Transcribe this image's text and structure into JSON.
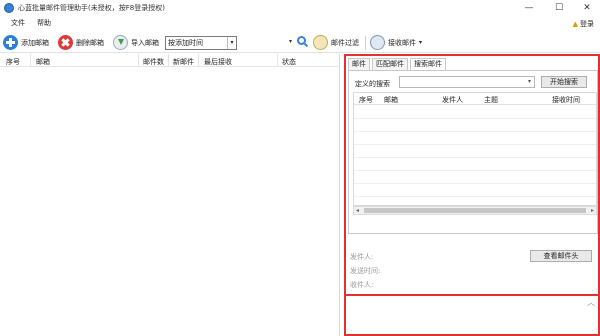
{
  "window": {
    "title": "心蓝批量邮件管理助手(未授权，按F8登录授权)",
    "minimize": "—",
    "maximize": "☐",
    "close": "✕"
  },
  "menu": {
    "file": "文件",
    "help": "帮助",
    "login": "登录"
  },
  "toolbar": {
    "add_label": "添加邮箱",
    "delete_label": "删除邮箱",
    "import_label": "导入邮箱",
    "sort_value": "按添加时间",
    "filter_label": "邮件过滤",
    "receive_label": "接收邮件"
  },
  "left_table": {
    "columns": [
      "序号",
      "邮箱",
      "邮件数",
      "新邮件",
      "最后接收",
      "状态"
    ]
  },
  "right": {
    "tabs": [
      "邮件",
      "匹配邮件",
      "搜索邮件"
    ],
    "custom_search_label": "定义的搜索",
    "start_search_button": "开始搜索",
    "grid_columns": [
      "序号",
      "邮箱",
      "发件人",
      "主题",
      "接收时间"
    ],
    "view_header_button": "查看邮件头",
    "details": {
      "sender": "发件人:",
      "send_time": "发送时间:",
      "recipient": "收件人:"
    }
  }
}
